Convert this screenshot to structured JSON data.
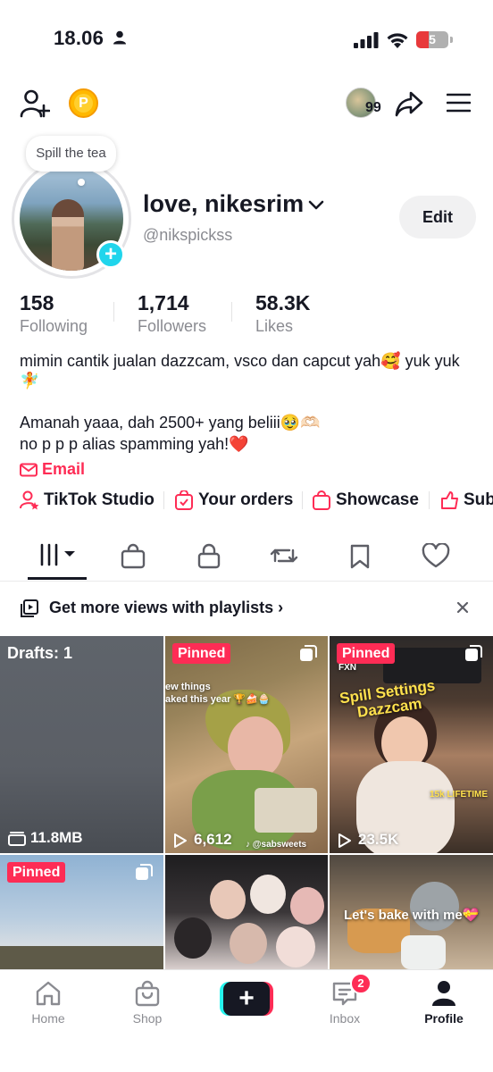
{
  "status_bar": {
    "time": "18.06",
    "battery": "5"
  },
  "top_bar": {
    "coin_letter": "P",
    "friends_count": "99"
  },
  "tooltip": {
    "text": "Spill the tea"
  },
  "profile": {
    "name": "love, nikesrim",
    "handle": "@nikspickss",
    "edit_label": "Edit"
  },
  "stats": [
    {
      "value": "158",
      "label": "Following"
    },
    {
      "value": "1,714",
      "label": "Followers"
    },
    {
      "value": "58.3K",
      "label": "Likes"
    }
  ],
  "bio": {
    "line1": "mimin cantik jualan dazzcam, vsco dan capcut yah🥰 yuk yuk",
    "line2": "🧚",
    "line3": "Amanah yaaa, dah 2500+ yang beliii🥹🫶🏻",
    "line4": "no p p p alias spamming yah!❤️",
    "email": "Email"
  },
  "quick_links": [
    "TikTok Studio",
    "Your orders",
    "Showcase",
    "Sub"
  ],
  "tabs": [
    "videos",
    "shop",
    "private",
    "reposts",
    "favorites",
    "liked"
  ],
  "promo": {
    "text": "Get more views with playlists"
  },
  "grid": {
    "drafts": {
      "label": "Drafts: 1",
      "size": "11.8MB"
    },
    "pinned_label": "Pinned",
    "videos": [
      {
        "views": "6,612",
        "caption": "ew things\naked this year 🏆🍰🧁",
        "watermark": "♪ @sabsweets"
      },
      {
        "views": "23.5K",
        "caption": "Spill Settings\nDazzcam",
        "sub": "15k LIFETIME",
        "ui_label": "FXN"
      },
      {
        "caption": ""
      },
      {
        "caption": ""
      },
      {
        "caption": "Let's bake with me💝"
      }
    ]
  },
  "bottom_nav": {
    "items": [
      "Home",
      "Shop",
      "",
      "Inbox",
      "Profile"
    ],
    "inbox_badge": "2"
  },
  "colors": {
    "accent": "#fe2c55",
    "cyan": "#25f4ee",
    "text": "#161823",
    "muted": "#8a8b91"
  }
}
